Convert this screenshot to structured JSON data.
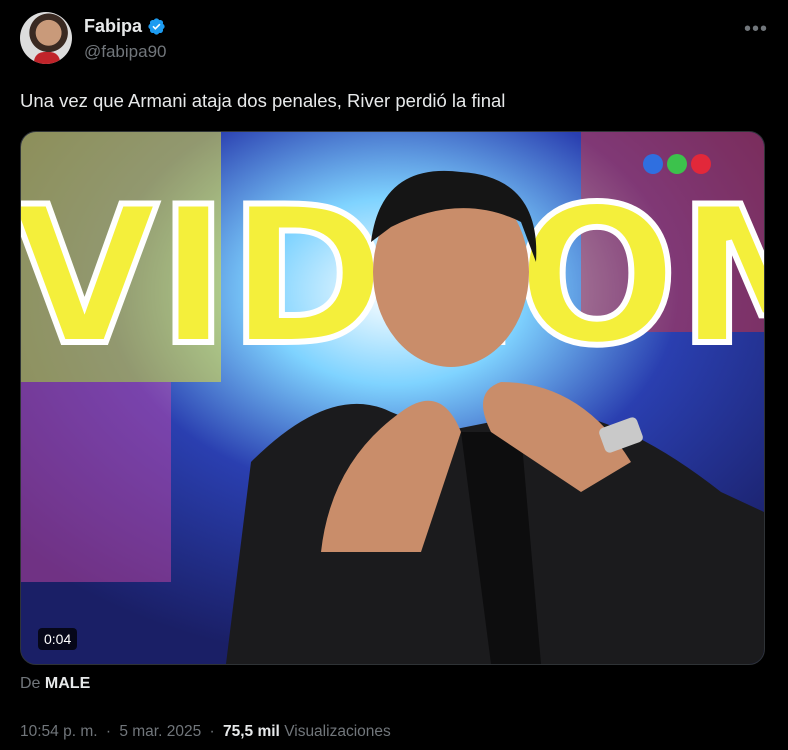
{
  "author": {
    "display_name": "Fabipa",
    "handle": "@fabipa90",
    "verified": true
  },
  "more_icon": "•••",
  "tweet": {
    "text": "Una vez que Armani ataja dos penales, River perdió la final"
  },
  "media": {
    "duration": "0:04",
    "background_text": "VIDEOM"
  },
  "source": {
    "prefix": "De",
    "name": "MALE"
  },
  "meta": {
    "time": "10:54 p. m.",
    "date": "5 mar. 2025",
    "separator": "·",
    "views_count": "75,5 mil",
    "views_label": "Visualizaciones"
  },
  "colors": {
    "background": "#000000",
    "text": "#e7e9ea",
    "muted": "#71767b",
    "verified": "#1d9bf0"
  }
}
